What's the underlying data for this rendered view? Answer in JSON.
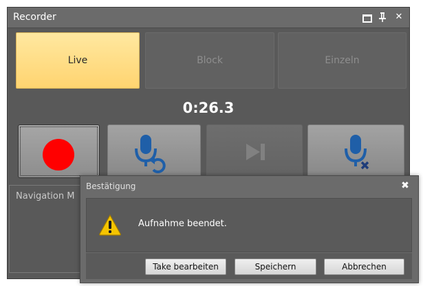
{
  "recorder": {
    "title": "Recorder",
    "controls": {
      "restore_icon": "restore-icon",
      "pin_icon": "pin-icon",
      "pin_glyph": " ",
      "close_glyph": "✕"
    },
    "modes": [
      {
        "label": "Live",
        "active": true
      },
      {
        "label": "Block",
        "active": false
      },
      {
        "label": "Einzeln",
        "active": false
      }
    ],
    "timer": "0:26.3",
    "actions": [
      {
        "name": "record",
        "icon": "record-dot-icon",
        "color": "#ff0000"
      },
      {
        "name": "mic-undo",
        "icon": "microphone-undo-icon",
        "color": "#1f5fa8"
      },
      {
        "name": "skip",
        "icon": "play-skip-icon",
        "enabled": false
      },
      {
        "name": "mic-delete",
        "icon": "microphone-delete-icon",
        "color": "#1f5fa8"
      }
    ],
    "navigation_label": "Navigation M"
  },
  "dialog": {
    "title": "Bestätigung",
    "close_glyph": "✖",
    "icon": "warning-icon",
    "message": "Aufnahme beendet.",
    "buttons": {
      "take_edit": "Take bearbeiten",
      "save": "Speichern",
      "cancel": "Abbrechen"
    }
  },
  "colors": {
    "panel_bg": "#595959",
    "active_mode": "#ffd470",
    "mic_blue": "#1f5fa8",
    "record_red": "#ff0000",
    "warning_yellow": "#f5c400"
  }
}
